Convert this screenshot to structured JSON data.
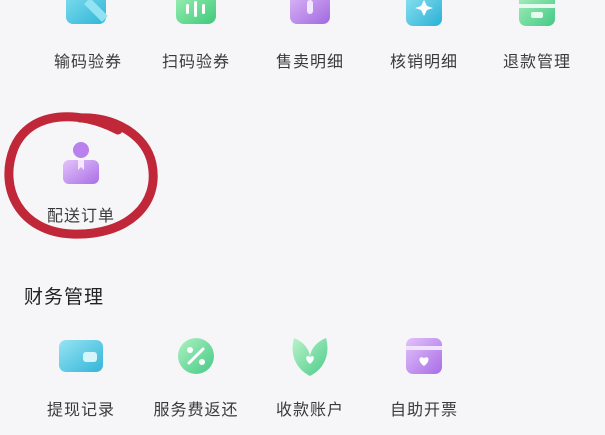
{
  "top_grid": [
    {
      "label": "输码验券",
      "icon": "ticket-pen-icon"
    },
    {
      "label": "扫码验券",
      "icon": "scan-ticket-icon"
    },
    {
      "label": "售卖明细",
      "icon": "sales-box-icon"
    },
    {
      "label": "核销明细",
      "icon": "verify-card-icon"
    },
    {
      "label": "退款管理",
      "icon": "refund-box-icon"
    }
  ],
  "delivery": {
    "label": "配送订单",
    "icon": "delivery-person-icon"
  },
  "finance": {
    "title": "财务管理",
    "items": [
      {
        "label": "提现记录",
        "icon": "wallet-icon"
      },
      {
        "label": "服务费返还",
        "icon": "percent-coin-icon"
      },
      {
        "label": "收款账户",
        "icon": "leaf-heart-icon"
      },
      {
        "label": "自助开票",
        "icon": "invoice-heart-icon"
      }
    ]
  },
  "colors": {
    "teal": "#43c6de",
    "green": "#5cd38f",
    "purple": "#b77ce8",
    "red_mark": "#c0283a"
  }
}
